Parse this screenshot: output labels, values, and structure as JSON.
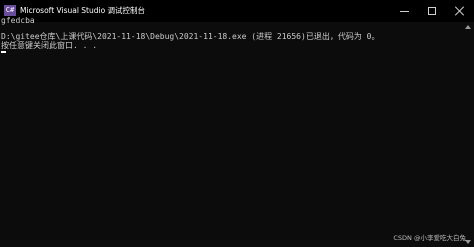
{
  "window": {
    "title": "Microsoft Visual Studio 调试控制台",
    "icon_text": "C#",
    "icon_color": "#6a4c9c"
  },
  "console": {
    "lines": [
      "gfedcba",
      "D:\\gitee仓库\\上课代码\\2021-11-18\\Debug\\2021-11-18.exe (进程 21656)已退出，代码为 0。",
      "按任意键关闭此窗口. . ."
    ],
    "text_color": "#cccccc",
    "background": "#0c0c0c"
  },
  "watermark": "CSDN @小李爱吃大白兔"
}
